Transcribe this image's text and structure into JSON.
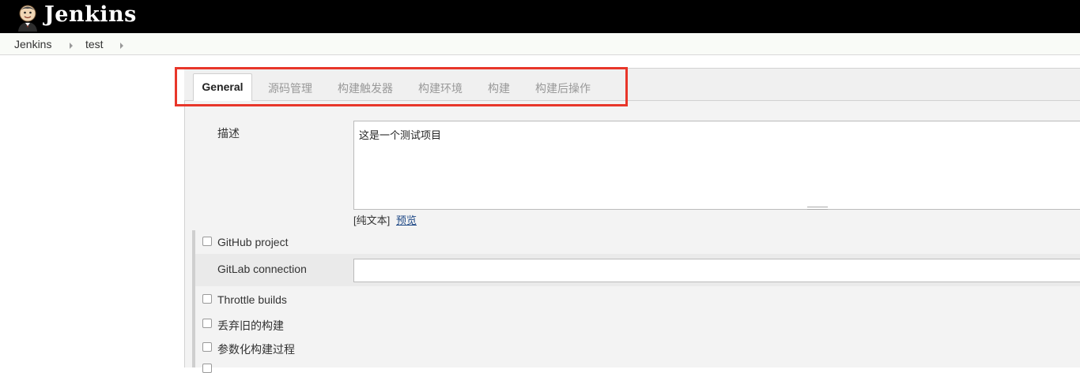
{
  "header": {
    "app_title": "Jenkins",
    "logo_icon": "jenkins-butler-icon"
  },
  "breadcrumb": {
    "items": [
      "Jenkins",
      "test"
    ]
  },
  "tabs": [
    "General",
    "源码管理",
    "构建触发器",
    "构建环境",
    "构建",
    "构建后操作"
  ],
  "form": {
    "description_label": "描述",
    "description_value": "这是一个测试项目",
    "plain_text_label": "[纯文本]",
    "preview_link": "预览",
    "github_project_label": "GitHub project",
    "gitlab_connection_label": "GitLab connection",
    "gitlab_connection_value": "",
    "throttle_builds_label": "Throttle builds",
    "discard_old_builds_label": "丢弃旧的构建",
    "parameterized_label": "参数化构建过程"
  },
  "colors": {
    "header_bg": "#000000",
    "highlight": "#e8362a",
    "link": "#204a87"
  }
}
